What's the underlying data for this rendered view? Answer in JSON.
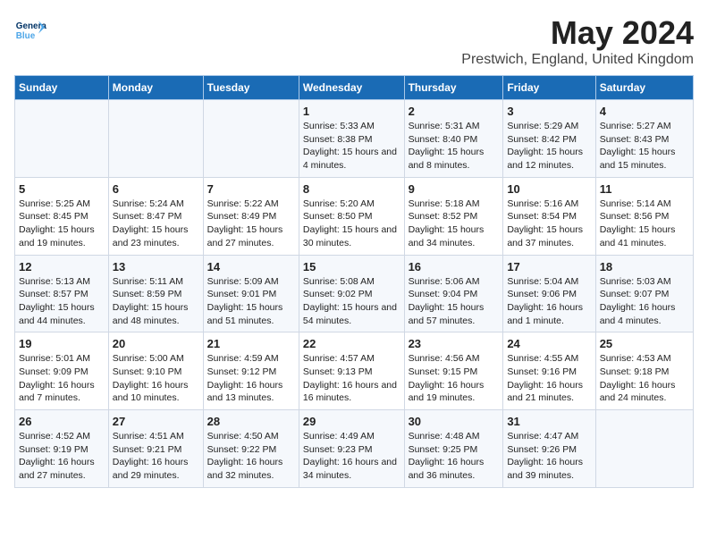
{
  "header": {
    "logo_general": "General",
    "logo_blue": "Blue",
    "main_title": "May 2024",
    "subtitle": "Prestwich, England, United Kingdom"
  },
  "days_of_week": [
    "Sunday",
    "Monday",
    "Tuesday",
    "Wednesday",
    "Thursday",
    "Friday",
    "Saturday"
  ],
  "weeks": [
    [
      {
        "day": "",
        "info": ""
      },
      {
        "day": "",
        "info": ""
      },
      {
        "day": "",
        "info": ""
      },
      {
        "day": "1",
        "info": "Sunrise: 5:33 AM\nSunset: 8:38 PM\nDaylight: 15 hours and 4 minutes."
      },
      {
        "day": "2",
        "info": "Sunrise: 5:31 AM\nSunset: 8:40 PM\nDaylight: 15 hours and 8 minutes."
      },
      {
        "day": "3",
        "info": "Sunrise: 5:29 AM\nSunset: 8:42 PM\nDaylight: 15 hours and 12 minutes."
      },
      {
        "day": "4",
        "info": "Sunrise: 5:27 AM\nSunset: 8:43 PM\nDaylight: 15 hours and 15 minutes."
      }
    ],
    [
      {
        "day": "5",
        "info": "Sunrise: 5:25 AM\nSunset: 8:45 PM\nDaylight: 15 hours and 19 minutes."
      },
      {
        "day": "6",
        "info": "Sunrise: 5:24 AM\nSunset: 8:47 PM\nDaylight: 15 hours and 23 minutes."
      },
      {
        "day": "7",
        "info": "Sunrise: 5:22 AM\nSunset: 8:49 PM\nDaylight: 15 hours and 27 minutes."
      },
      {
        "day": "8",
        "info": "Sunrise: 5:20 AM\nSunset: 8:50 PM\nDaylight: 15 hours and 30 minutes."
      },
      {
        "day": "9",
        "info": "Sunrise: 5:18 AM\nSunset: 8:52 PM\nDaylight: 15 hours and 34 minutes."
      },
      {
        "day": "10",
        "info": "Sunrise: 5:16 AM\nSunset: 8:54 PM\nDaylight: 15 hours and 37 minutes."
      },
      {
        "day": "11",
        "info": "Sunrise: 5:14 AM\nSunset: 8:56 PM\nDaylight: 15 hours and 41 minutes."
      }
    ],
    [
      {
        "day": "12",
        "info": "Sunrise: 5:13 AM\nSunset: 8:57 PM\nDaylight: 15 hours and 44 minutes."
      },
      {
        "day": "13",
        "info": "Sunrise: 5:11 AM\nSunset: 8:59 PM\nDaylight: 15 hours and 48 minutes."
      },
      {
        "day": "14",
        "info": "Sunrise: 5:09 AM\nSunset: 9:01 PM\nDaylight: 15 hours and 51 minutes."
      },
      {
        "day": "15",
        "info": "Sunrise: 5:08 AM\nSunset: 9:02 PM\nDaylight: 15 hours and 54 minutes."
      },
      {
        "day": "16",
        "info": "Sunrise: 5:06 AM\nSunset: 9:04 PM\nDaylight: 15 hours and 57 minutes."
      },
      {
        "day": "17",
        "info": "Sunrise: 5:04 AM\nSunset: 9:06 PM\nDaylight: 16 hours and 1 minute."
      },
      {
        "day": "18",
        "info": "Sunrise: 5:03 AM\nSunset: 9:07 PM\nDaylight: 16 hours and 4 minutes."
      }
    ],
    [
      {
        "day": "19",
        "info": "Sunrise: 5:01 AM\nSunset: 9:09 PM\nDaylight: 16 hours and 7 minutes."
      },
      {
        "day": "20",
        "info": "Sunrise: 5:00 AM\nSunset: 9:10 PM\nDaylight: 16 hours and 10 minutes."
      },
      {
        "day": "21",
        "info": "Sunrise: 4:59 AM\nSunset: 9:12 PM\nDaylight: 16 hours and 13 minutes."
      },
      {
        "day": "22",
        "info": "Sunrise: 4:57 AM\nSunset: 9:13 PM\nDaylight: 16 hours and 16 minutes."
      },
      {
        "day": "23",
        "info": "Sunrise: 4:56 AM\nSunset: 9:15 PM\nDaylight: 16 hours and 19 minutes."
      },
      {
        "day": "24",
        "info": "Sunrise: 4:55 AM\nSunset: 9:16 PM\nDaylight: 16 hours and 21 minutes."
      },
      {
        "day": "25",
        "info": "Sunrise: 4:53 AM\nSunset: 9:18 PM\nDaylight: 16 hours and 24 minutes."
      }
    ],
    [
      {
        "day": "26",
        "info": "Sunrise: 4:52 AM\nSunset: 9:19 PM\nDaylight: 16 hours and 27 minutes."
      },
      {
        "day": "27",
        "info": "Sunrise: 4:51 AM\nSunset: 9:21 PM\nDaylight: 16 hours and 29 minutes."
      },
      {
        "day": "28",
        "info": "Sunrise: 4:50 AM\nSunset: 9:22 PM\nDaylight: 16 hours and 32 minutes."
      },
      {
        "day": "29",
        "info": "Sunrise: 4:49 AM\nSunset: 9:23 PM\nDaylight: 16 hours and 34 minutes."
      },
      {
        "day": "30",
        "info": "Sunrise: 4:48 AM\nSunset: 9:25 PM\nDaylight: 16 hours and 36 minutes."
      },
      {
        "day": "31",
        "info": "Sunrise: 4:47 AM\nSunset: 9:26 PM\nDaylight: 16 hours and 39 minutes."
      },
      {
        "day": "",
        "info": ""
      }
    ]
  ]
}
